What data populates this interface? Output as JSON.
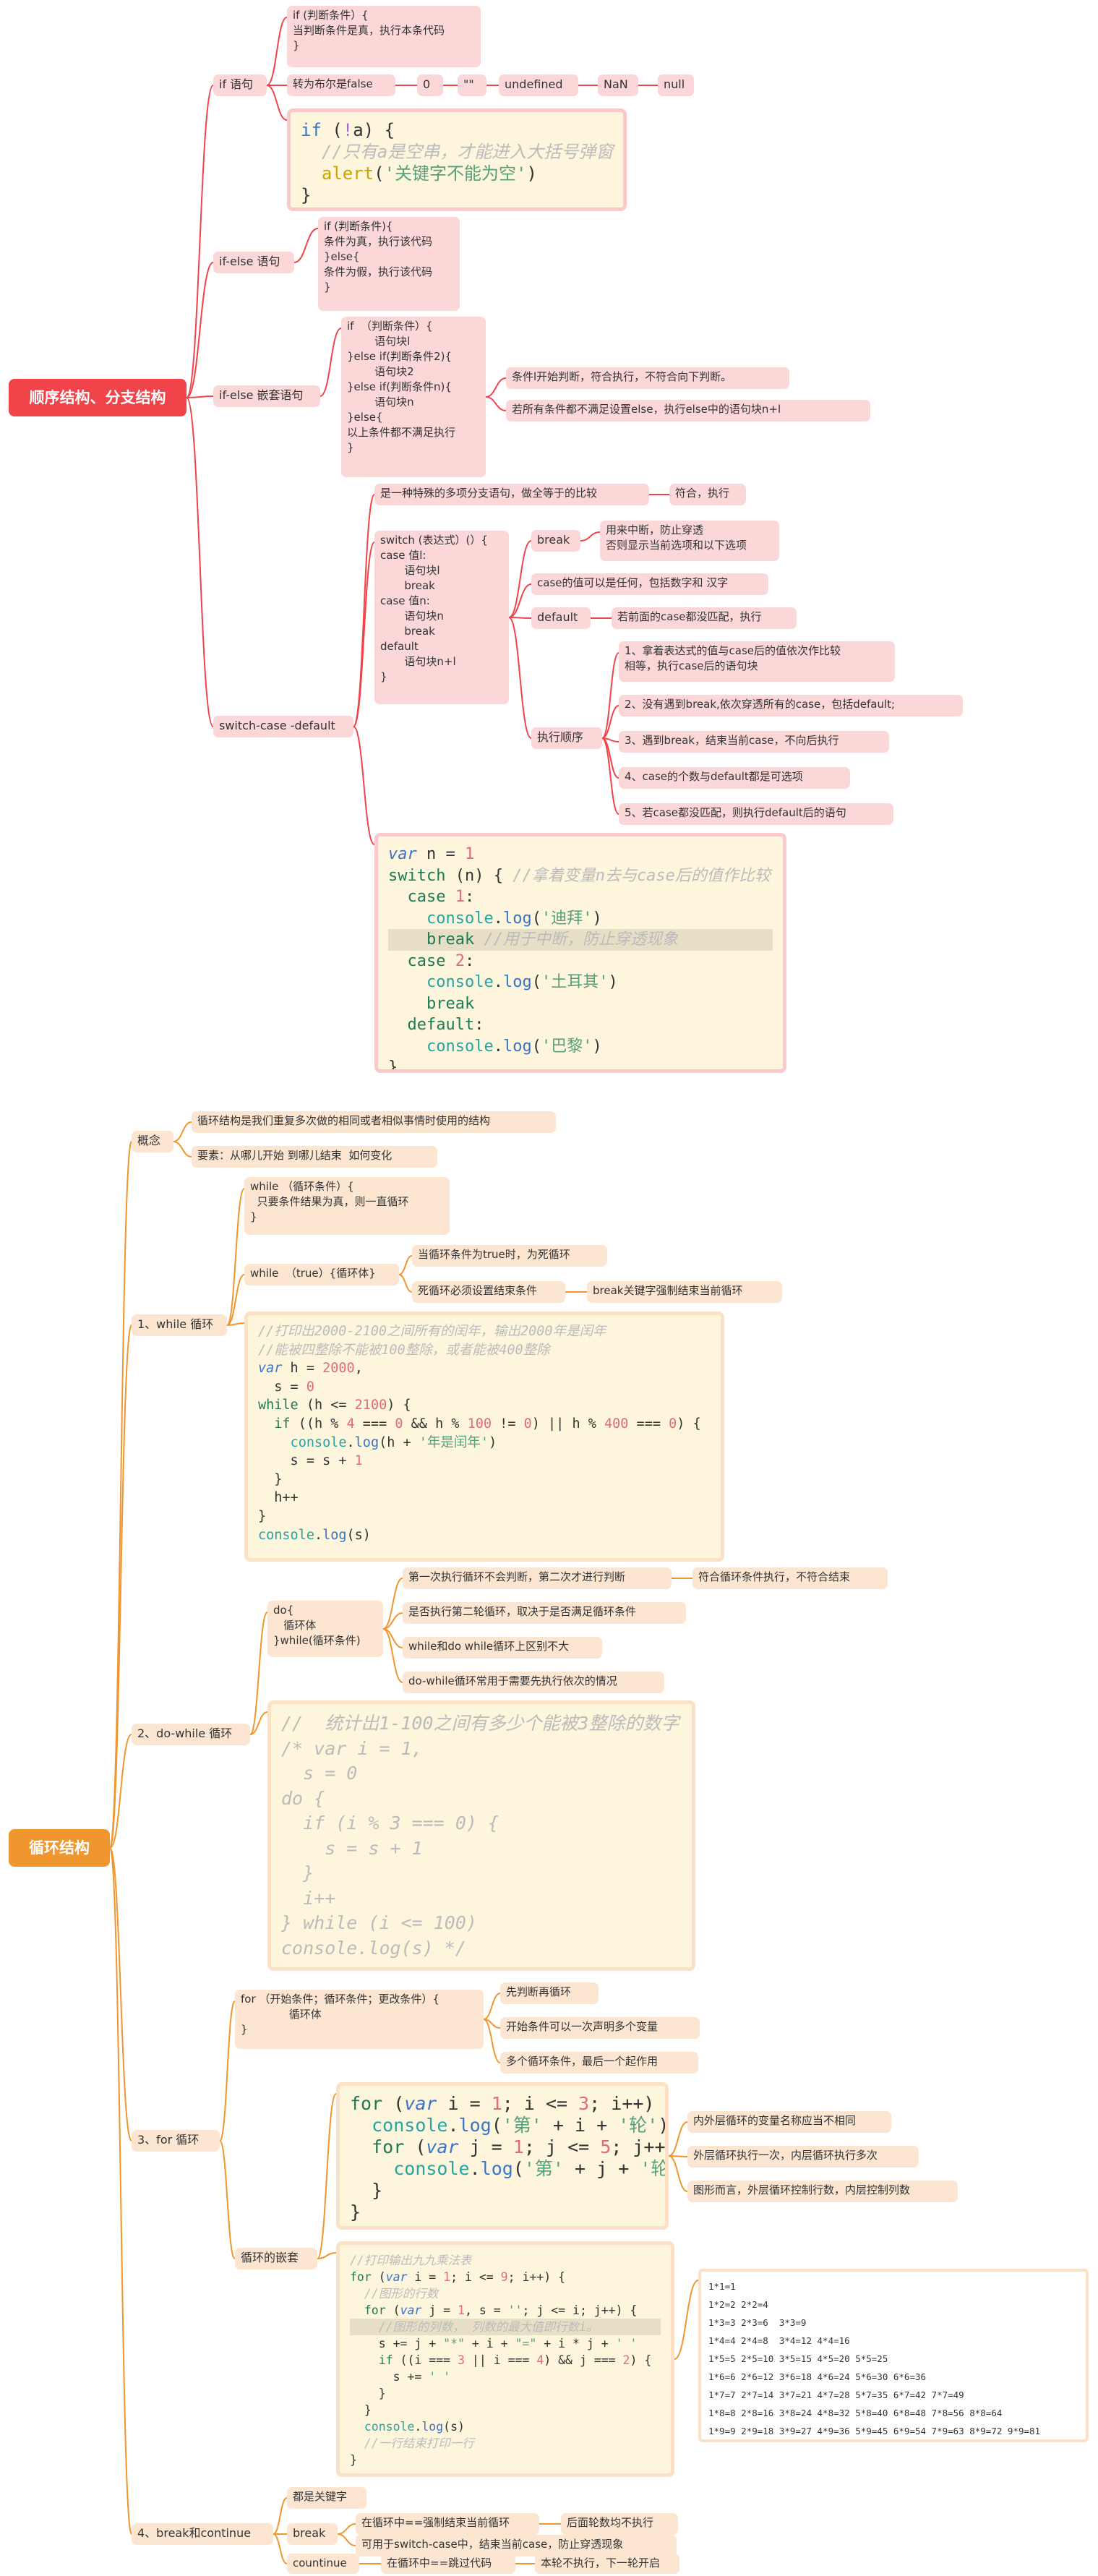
{
  "colors": {
    "red_branch": "#f0434a",
    "orange_branch": "#f0962e",
    "pink_node": "#fbd7d8",
    "peach_node": "#fce6d2",
    "code_bg": "#fdf5dc"
  },
  "sections": [
    {
      "id": "branch",
      "title": "顺序结构、分支结构"
    },
    {
      "id": "loop",
      "title": "循环结构"
    }
  ],
  "nodes": {
    "if_label": "if 语句",
    "if_syntax": "if (判断条件）{\n当判断条件是真，执行本条代码\n}",
    "if_bool_label": "转为布尔是false",
    "falsy_0": "0",
    "falsy_1": "\"\"",
    "falsy_2": "undefined",
    "falsy_3": "NaN",
    "falsy_4": "null",
    "ifelse_label": "if-else 语句",
    "ifelse_syntax": "if (判断条件){\n条件为真，执行该代码\n}else{\n条件为假，执行该代码\n}",
    "ifnest_label": "if-else 嵌套语句",
    "ifnest_syntax": "if  （判断条件）{\n        语句块l\n}else if(判断条件2){\n        语句块2\n}else if(判断条件n){\n        语句块n\n}else{\n以上条件都不满足执行\n}",
    "ifnest_note1": "条件l开始判断，符合执行，不符合向下判断。",
    "ifnest_note2": "若所有条件都不满足设置else，执行else中的语句块n+l",
    "switch_label": "switch-case -default",
    "switch_desc": "是一种特殊的多项分支语句，做全等于的比较",
    "switch_desc2": "符合，执行",
    "switch_syntax": "switch (表达式）(）{\ncase 值l:\n       语句块l\n       break\ncase 值n:\n       语句块n\n       break\ndefault\n       语句块n+l\n}",
    "break_label": "break",
    "break_desc": "用来中断，防止穿透\n否则显示当前选项和以下选项",
    "case_desc": "case的值可以是任何，包括数字和 汉字",
    "default_label": "default",
    "default_desc": "若前面的case都没匹配，执行",
    "order_label": "执行顺序",
    "order_1": "1、拿着表达式的值与case后的值依次作比较\n相等，执行case后的语句块",
    "order_2": "2、没有遇到break,依次穿透所有的case，包括default;",
    "order_3": "3、遇到break，结束当前case，不向后执行",
    "order_4": "4、case的个数与default都是可选项",
    "order_5": "5、若case都没匹配，则执行default后的语句",
    "concept_label": "概念",
    "concept_1": "循环结构是我们重复多次做的相同或者相似事情时使用的结构",
    "concept_2": "要素：从哪儿开始 到哪儿结束  如何变化",
    "while_label": "1、while 循环",
    "while_syntax": "while （循环条件）{\n  只要条件结果为真，则一直循环\n}",
    "whiletrue_label": "while  （true）{循环体}",
    "whiletrue_1": "当循环条件为true时，为死循环",
    "whiletrue_2": "死循环必须设置结束条件",
    "whiletrue_3": "break关键字强制结束当前循环",
    "dowhile_label": "2、do-while 循环",
    "dowhile_syntax": "do{\n   循环体\n}while(循环条件)",
    "dowhile_1": "第一次执行循环不会判断，第二次才进行判断",
    "dowhile_1b": "符合循环条件执行，不符合结束",
    "dowhile_2": "是否执行第二轮循环，取决于是否满足循环条件",
    "dowhile_3": "while和do while循环上区别不大",
    "dowhile_4": "do-while循环常用于需要先执行依次的情况",
    "for_label": "3、for 循环",
    "for_syntax": "for （开始条件；循环条件；更改条件）{\n              循环体\n}",
    "for_1": "先判断再循环",
    "for_2": "开始条件可以一次声明多个变量",
    "for_3": "多个循环条件，最后一个起作用",
    "nest_label": "循环的嵌套",
    "nest_1": "内外层循环的变量名称应当不相同",
    "nest_2": "外层循环执行一次，内层循环执行多次",
    "nest_3": "图形而言，外层循环控制行数，内层控制列数",
    "bc_label": "4、break和continue",
    "bc_1": "都是关键字",
    "bc_break": "break",
    "bc_break_1": "在循环中==强制结束当前循环",
    "bc_break_1b": "后面轮数均不执行",
    "bc_break_2": "可用于switch-case中，结束当前case，防止穿透现象",
    "bc_cont": "countinue",
    "bc_cont_1": "在循环中==跳过代码",
    "bc_cont_1b": "本轮不执行，下一轮开启"
  },
  "code_blocks": {
    "if_code": [
      [
        [
          "kw",
          "if"
        ],
        [
          "pl",
          " ("
        ],
        [
          "op",
          "!"
        ],
        [
          "pl",
          "a) {"
        ]
      ],
      [
        [
          "pl",
          "  "
        ],
        [
          "cm",
          "//只有a是空串，才能进入大括号弹窗"
        ]
      ],
      [
        [
          "pl",
          "  "
        ],
        [
          "y",
          "alert"
        ],
        [
          "pl",
          "("
        ],
        [
          "str",
          "'关键字不能为空'"
        ],
        [
          "pl",
          ")"
        ]
      ],
      [
        [
          "pl",
          "}"
        ]
      ]
    ],
    "switch_code": [
      [
        [
          "kw i",
          "var"
        ],
        [
          "pl",
          " n = "
        ],
        [
          "num",
          "1"
        ]
      ],
      [
        [
          "ybr",
          "switch"
        ],
        [
          "pl",
          " (n) { "
        ],
        [
          "cm",
          "//拿着变量n去与case后的值作比较"
        ]
      ],
      [
        [
          "pl",
          "  "
        ],
        [
          "ybr",
          "case"
        ],
        [
          "pl",
          " "
        ],
        [
          "num",
          "1"
        ],
        [
          "pl",
          ":"
        ]
      ],
      [
        [
          "pl",
          "    "
        ],
        [
          "fn",
          "console"
        ],
        [
          "pl",
          "."
        ],
        [
          "kw",
          "log"
        ],
        [
          "pl",
          "("
        ],
        [
          "str",
          "'迪拜'"
        ],
        [
          "pl",
          ")"
        ]
      ],
      [
        [
          "pl",
          "    "
        ],
        [
          "ybr",
          "break"
        ],
        [
          "pl",
          " "
        ],
        [
          "cm",
          "//用于中断，防止穿透现象"
        ]
      ],
      [
        [
          "pl",
          "  "
        ],
        [
          "ybr",
          "case"
        ],
        [
          "pl",
          " "
        ],
        [
          "num",
          "2"
        ],
        [
          "pl",
          ":"
        ]
      ],
      [
        [
          "pl",
          "    "
        ],
        [
          "fn",
          "console"
        ],
        [
          "pl",
          "."
        ],
        [
          "kw",
          "log"
        ],
        [
          "pl",
          "("
        ],
        [
          "str",
          "'土耳其'"
        ],
        [
          "pl",
          ")"
        ]
      ],
      [
        [
          "pl",
          "    "
        ],
        [
          "ybr",
          "break"
        ]
      ],
      [
        [
          "pl",
          "  "
        ],
        [
          "ybr",
          "default"
        ],
        [
          "pl",
          ":"
        ]
      ],
      [
        [
          "pl",
          "    "
        ],
        [
          "fn",
          "console"
        ],
        [
          "pl",
          "."
        ],
        [
          "kw",
          "log"
        ],
        [
          "pl",
          "("
        ],
        [
          "str",
          "'巴黎'"
        ],
        [
          "pl",
          ")"
        ]
      ],
      [
        [
          "pl",
          "}"
        ]
      ]
    ],
    "while_code": [
      [
        [
          "cm",
          "//打印出2000-2100之间所有的闰年，输出2000年是闰年"
        ]
      ],
      [
        [
          "cm",
          "//能被四整除不能被100整除，或者能被400整除"
        ]
      ],
      [
        [
          "kw i",
          "var"
        ],
        [
          "pl",
          " h = "
        ],
        [
          "num",
          "2000"
        ],
        [
          "pl",
          ","
        ]
      ],
      [
        [
          "pl",
          "  s = "
        ],
        [
          "num",
          "0"
        ]
      ],
      [
        [
          "ybr",
          "while"
        ],
        [
          "pl",
          " (h <= "
        ],
        [
          "num",
          "2100"
        ],
        [
          "pl",
          ") {"
        ]
      ],
      [
        [
          "pl",
          "  "
        ],
        [
          "ybr",
          "if"
        ],
        [
          "pl",
          " ((h % "
        ],
        [
          "num",
          "4"
        ],
        [
          "pl",
          " === "
        ],
        [
          "num",
          "0"
        ],
        [
          "pl",
          " && h % "
        ],
        [
          "num",
          "100"
        ],
        [
          "pl",
          " != "
        ],
        [
          "num",
          "0"
        ],
        [
          "pl",
          ") || h % "
        ],
        [
          "num",
          "400"
        ],
        [
          "pl",
          " === "
        ],
        [
          "num",
          "0"
        ],
        [
          "pl",
          ") {"
        ]
      ],
      [
        [
          "pl",
          "    "
        ],
        [
          "fn",
          "console"
        ],
        [
          "pl",
          "."
        ],
        [
          "kw",
          "log"
        ],
        [
          "pl",
          "(h + "
        ],
        [
          "str",
          "'年是闰年'"
        ],
        [
          "pl",
          ")"
        ]
      ],
      [
        [
          "pl",
          "    s = s + "
        ],
        [
          "num",
          "1"
        ]
      ],
      [
        [
          "pl",
          "  }"
        ]
      ],
      [
        [
          "pl",
          "  h++"
        ]
      ],
      [
        [
          "pl",
          "}"
        ]
      ],
      [
        [
          "fn",
          "console"
        ],
        [
          "pl",
          "."
        ],
        [
          "kw",
          "log"
        ],
        [
          "pl",
          "(s)"
        ]
      ]
    ],
    "dowhile_code": [
      [
        [
          "cm",
          "//  统计出1-100之间有多少个能被3整除的数字"
        ]
      ],
      [
        [
          "cm",
          "/* var i = 1,"
        ]
      ],
      [
        [
          "cm",
          "  s = 0"
        ]
      ],
      [
        [
          "cm",
          "do {"
        ]
      ],
      [
        [
          "cm",
          "  if (i % 3 === 0) {"
        ]
      ],
      [
        [
          "cm",
          "    s = s + 1"
        ]
      ],
      [
        [
          "cm",
          "  }"
        ]
      ],
      [
        [
          "cm",
          "  i++"
        ]
      ],
      [
        [
          "cm",
          "} while (i <= 100)"
        ]
      ],
      [
        [
          "cm",
          "console.log(s) */"
        ]
      ]
    ],
    "for_code": [
      [
        [
          "ybr",
          "for"
        ],
        [
          "pl",
          " ("
        ],
        [
          "kw i",
          "var"
        ],
        [
          "pl",
          " i = "
        ],
        [
          "num",
          "1"
        ],
        [
          "pl",
          "; i <= "
        ],
        [
          "num",
          "3"
        ],
        [
          "pl",
          "; i++) {"
        ]
      ],
      [
        [
          "pl",
          "  "
        ],
        [
          "fn",
          "console"
        ],
        [
          "pl",
          "."
        ],
        [
          "kw",
          "log"
        ],
        [
          "pl",
          "("
        ],
        [
          "str",
          "'第'"
        ],
        [
          "pl",
          " + i + "
        ],
        [
          "str",
          "'轮'"
        ],
        [
          "pl",
          ")"
        ]
      ],
      [
        [
          "pl",
          "  "
        ],
        [
          "ybr",
          "for"
        ],
        [
          "pl",
          " ("
        ],
        [
          "kw i",
          "var"
        ],
        [
          "pl",
          " j = "
        ],
        [
          "num",
          "1"
        ],
        [
          "pl",
          "; j <= "
        ],
        [
          "num",
          "5"
        ],
        [
          "pl",
          "; j++) {"
        ]
      ],
      [
        [
          "pl",
          "    "
        ],
        [
          "fn",
          "console"
        ],
        [
          "pl",
          "."
        ],
        [
          "kw",
          "log"
        ],
        [
          "pl",
          "("
        ],
        [
          "str",
          "'第'"
        ],
        [
          "pl",
          " + j + "
        ],
        [
          "str",
          "'轮'"
        ],
        [
          "pl",
          ")"
        ]
      ],
      [
        [
          "pl",
          "  }"
        ]
      ],
      [
        [
          "pl",
          "}"
        ]
      ]
    ],
    "table_code": [
      [
        [
          "cm",
          "//打印输出九九乘法表"
        ]
      ],
      [
        [
          "ybr",
          "for"
        ],
        [
          "pl",
          " ("
        ],
        [
          "kw i",
          "var"
        ],
        [
          "pl",
          " i = "
        ],
        [
          "num",
          "1"
        ],
        [
          "pl",
          "; i <= "
        ],
        [
          "num",
          "9"
        ],
        [
          "pl",
          "; i++) {"
        ]
      ],
      [
        [
          "pl",
          "  "
        ],
        [
          "cm",
          "//图形的行数"
        ]
      ],
      [
        [
          "pl",
          "  "
        ],
        [
          "ybr",
          "for"
        ],
        [
          "pl",
          " ("
        ],
        [
          "kw i",
          "var"
        ],
        [
          "pl",
          " j = "
        ],
        [
          "num",
          "1"
        ],
        [
          "pl",
          ", s = "
        ],
        [
          "str",
          "''"
        ],
        [
          "pl",
          "; j <= i; j++) {"
        ]
      ],
      [
        [
          "pl",
          "    "
        ],
        [
          "cm",
          "//图形的列数， 列数的最大值即行数i。"
        ]
      ],
      [
        [
          "pl",
          "    s += j + "
        ],
        [
          "str",
          "\"*\""
        ],
        [
          "pl",
          " + i + "
        ],
        [
          "str",
          "\"=\""
        ],
        [
          "pl",
          " + i * j + "
        ],
        [
          "str",
          "' '"
        ]
      ],
      [
        [
          "pl",
          "    "
        ],
        [
          "ybr",
          "if"
        ],
        [
          "pl",
          " ((i === "
        ],
        [
          "num",
          "3"
        ],
        [
          "pl",
          " || i === "
        ],
        [
          "num",
          "4"
        ],
        [
          "pl",
          ") && j === "
        ],
        [
          "num",
          "2"
        ],
        [
          "pl",
          ") {"
        ]
      ],
      [
        [
          "pl",
          "      s += "
        ],
        [
          "str",
          "' '"
        ]
      ],
      [
        [
          "pl",
          "    }"
        ]
      ],
      [
        [
          "pl",
          "  }"
        ]
      ],
      [
        [
          "pl",
          "  "
        ],
        [
          "fn",
          "console"
        ],
        [
          "pl",
          "."
        ],
        [
          "kw",
          "log"
        ],
        [
          "pl",
          "(s)"
        ]
      ],
      [
        [
          "pl",
          "  "
        ],
        [
          "cm",
          "//一行结束打印一行"
        ]
      ],
      [
        [
          "pl",
          "}"
        ]
      ]
    ]
  },
  "output_table": [
    "1*1=1",
    "1*2=2 2*2=4",
    "1*3=3 2*3=6  3*3=9",
    "1*4=4 2*4=8  3*4=12 4*4=16",
    "1*5=5 2*5=10 3*5=15 4*5=20 5*5=25",
    "1*6=6 2*6=12 3*6=18 4*6=24 5*6=30 6*6=36",
    "1*7=7 2*7=14 3*7=21 4*7=28 5*7=35 6*7=42 7*7=49",
    "1*8=8 2*8=16 3*8=24 4*8=32 5*8=40 6*8=48 7*8=56 8*8=64",
    "1*9=9 2*9=18 3*9=27 4*9=36 5*9=45 6*9=54 7*9=63 8*9=72 9*9=81"
  ]
}
